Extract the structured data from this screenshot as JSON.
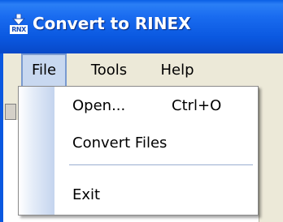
{
  "window": {
    "title": "Convert to RINEX",
    "icon_label": "RNX",
    "icon_name": "rinex-app-icon",
    "title_bar_color": "#0a58e0"
  },
  "menubar": {
    "items": [
      {
        "label": "File",
        "active": true
      },
      {
        "label": "Tools",
        "active": false
      },
      {
        "label": "Help",
        "active": false
      }
    ]
  },
  "file_menu": {
    "items": [
      {
        "label": "Open...",
        "shortcut": "Ctrl+O"
      },
      {
        "label": "Convert Files",
        "shortcut": ""
      },
      {
        "label": "Exit",
        "shortcut": ""
      }
    ]
  }
}
